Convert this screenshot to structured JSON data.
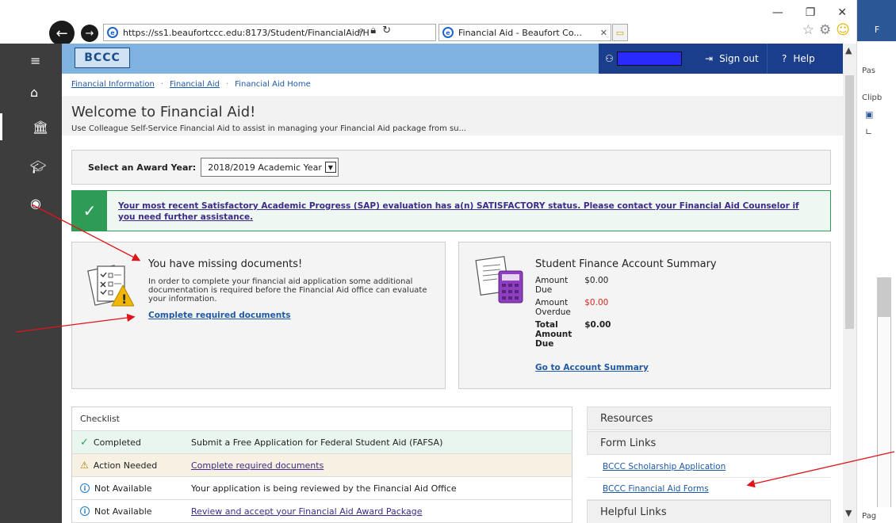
{
  "browser": {
    "url": "https://ss1.beaufortccc.edu:8173/Student/FinancialAid/H",
    "tab_title": "Financial Aid - Beaufort Co...",
    "win_min": "—",
    "win_max": "❐",
    "win_close": "✕"
  },
  "header": {
    "logo_text": "BCCC",
    "sign_out": "Sign out",
    "help": "Help"
  },
  "breadcrumb": [
    "Financial Information",
    "Financial Aid",
    "Financial Aid Home"
  ],
  "page": {
    "title": "Welcome to Financial Aid!",
    "subtitle": "Use Colleague Self-Service Financial Aid to assist in managing your Financial Aid package from su..."
  },
  "award_year": {
    "label": "Select an Award Year:",
    "selected": "2018/2019 Academic Year"
  },
  "sap": {
    "message": "Your most recent Satisfactory Academic Progress (SAP) evaluation has a(n) SATISFACTORY status. Please contact your Financial Aid Counselor if you need further assistance."
  },
  "missing_docs": {
    "title": "You have missing documents!",
    "text": "In order to complete your financial aid application some additional documentation is required before the Financial Aid office can evaluate your information.",
    "link": "Complete required documents"
  },
  "account_summary": {
    "title": "Student Finance Account Summary",
    "rows": [
      {
        "label": "Amount Due",
        "value": "$0.00"
      },
      {
        "label": "Amount Overdue",
        "value": "$0.00"
      },
      {
        "label": "Total Amount Due",
        "value": "$0.00"
      }
    ],
    "link": "Go to Account Summary"
  },
  "checklist": {
    "header": "Checklist",
    "rows": [
      {
        "status": "Completed",
        "desc": "Submit a Free Application for Federal Student Aid (FAFSA)"
      },
      {
        "status": "Action Needed",
        "desc": "Complete required documents"
      },
      {
        "status": "Not Available",
        "desc": "Your application is being reviewed by the Financial Aid Office"
      },
      {
        "status": "Not Available",
        "desc": "Review and accept your Financial Aid Award Package"
      }
    ]
  },
  "resources": {
    "title": "Resources",
    "form_links_title": "Form Links",
    "links": [
      "BCCC Scholarship Application",
      "BCCC Financial Aid Forms"
    ],
    "helpful_links_title": "Helpful Links"
  },
  "word_panel": {
    "ribbon_letter": "F",
    "paste": "Pas",
    "clipboard": "Clipb",
    "page": "Pag"
  },
  "colors": {
    "sidebar": "#3d3d3d",
    "header": "#7fb2de",
    "userbar": "#1b3e8c",
    "success": "#2e9c56",
    "link": "#1f5aa6",
    "danger": "#d9261c"
  }
}
